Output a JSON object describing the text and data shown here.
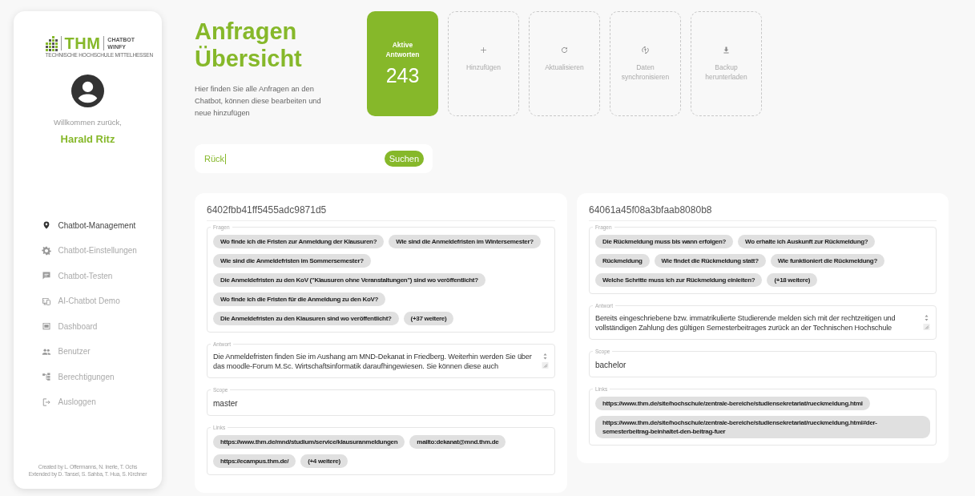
{
  "sidebar": {
    "logo": {
      "mark": "THM",
      "product_lines": [
        "CHATBOT",
        "WINFY"
      ],
      "subtitle": "TECHNISCHE HOCHSCHULE MITTELHESSEN"
    },
    "welcome": "Willkommen zurück,",
    "user_name": "Harald Ritz",
    "nav": [
      {
        "kind": "pin",
        "label": "Chatbot-Management",
        "selected": true
      },
      {
        "kind": "gear",
        "label": "Chatbot-Einstellungen",
        "selected": false
      },
      {
        "kind": "chat",
        "label": "Chatbot-Testen",
        "selected": false
      },
      {
        "kind": "demo",
        "label": "AI-Chatbot Demo",
        "selected": false
      },
      {
        "kind": "dashboard",
        "label": "Dashboard",
        "selected": false
      },
      {
        "kind": "people",
        "label": "Benutzer",
        "selected": false
      },
      {
        "kind": "permissions",
        "label": "Berechtigungen",
        "selected": false
      },
      {
        "kind": "logout",
        "label": "Ausloggen",
        "selected": false
      }
    ],
    "credits": [
      "Created by L. Offermanns, N. Inerle, T. Ochs",
      "Extended by D. Tansel, S. Sahba, T. Hua, S. Kirchner"
    ]
  },
  "header": {
    "title_lines": [
      "Anfragen",
      "Übersicht"
    ],
    "description": "Hier finden Sie alle Anfragen an den Chatbot, können diese bearbeiten und neue hinzufügen"
  },
  "stat": {
    "label": "Aktive Antworten",
    "value": "243"
  },
  "actions": [
    {
      "kind": "plus",
      "label": "Hinzufügen"
    },
    {
      "kind": "refresh",
      "label": "Aktualisieren"
    },
    {
      "kind": "sync",
      "label": "Daten synchronisieren"
    },
    {
      "kind": "download",
      "label": "Backup herunterladen"
    }
  ],
  "search": {
    "value": "Rück",
    "button": "Suchen"
  },
  "cards": [
    {
      "id": "6402fbb41ff5455adc9871d5",
      "fields": [
        {
          "kind": "chips",
          "label": "Fragen",
          "chips": [
            "Wo finde ich die Fristen zur Anmeldung der Klausuren?",
            "Wie sind die Anmeldefristen im Wintersemester?",
            "Wie sind die Anmeldefristen im Sommersemester?",
            "Die Anmeldefristen zu den KoV (\"Klausuren ohne Veranstaltungen\") sind wo veröffentlicht?",
            "Wo finde ich die Fristen für die Anmeldung zu den KoV?",
            "Die Anmeldefristen zu den Klausuren sind wo veröffentlicht?",
            "(+37 weitere)"
          ]
        },
        {
          "kind": "textarea",
          "label": "Antwort",
          "value": "Die Anmeldefristen finden Sie im Aushang am MND-Dekanat in Friedberg. Weiterhin werden Sie über das moodle-Forum M.Sc. Wirtschaftsinformatik daraufhingewiesen. Sie können diese auch"
        },
        {
          "kind": "text",
          "label": "Scope",
          "value": "master"
        },
        {
          "kind": "chips",
          "label": "Links",
          "chips": [
            "https://www.thm.de/mnd/studium/service/klausuranmeldungen",
            "mailto:dekanat@mnd.thm.de",
            "https://ecampus.thm.de/",
            "(+4 weitere)"
          ]
        }
      ]
    },
    {
      "id": "64061a45f08a3bfaab8080b8",
      "fields": [
        {
          "kind": "chips",
          "label": "Fragen",
          "chips": [
            "Die Rückmeldung muss bis wann erfolgen?",
            "Wo erhalte ich Auskunft zur Rückmeldung?",
            "Rückmeldung",
            "Wie findet die Rückmeldung statt?",
            "Wie funktioniert die Rückmeldung?",
            "Welche Schritte muss ich zur Rückmeldung einleiten?",
            "(+18 weitere)"
          ]
        },
        {
          "kind": "textarea",
          "label": "Antwort",
          "value": "Bereits eingeschriebene bzw. immatrikulierte Studierende melden sich mit der rechtzeitigen und vollständigen Zahlung des gültigen Semesterbeitrages zurück an der Technischen Hochschule"
        },
        {
          "kind": "text",
          "label": "Scope",
          "value": "bachelor"
        },
        {
          "kind": "chips",
          "label": "Links",
          "chips": [
            "https://www.thm.de/site/hochschule/zentrale-bereiche/studiensekretariat/rueckmeldung.html",
            "https://www.thm.de/site/hochschule/zentrale-bereiche/studiensekretariat/rueckmeldung.html#der-semesterbeitrag-beinhaltet-den-beitrag-fuer"
          ]
        }
      ]
    }
  ]
}
